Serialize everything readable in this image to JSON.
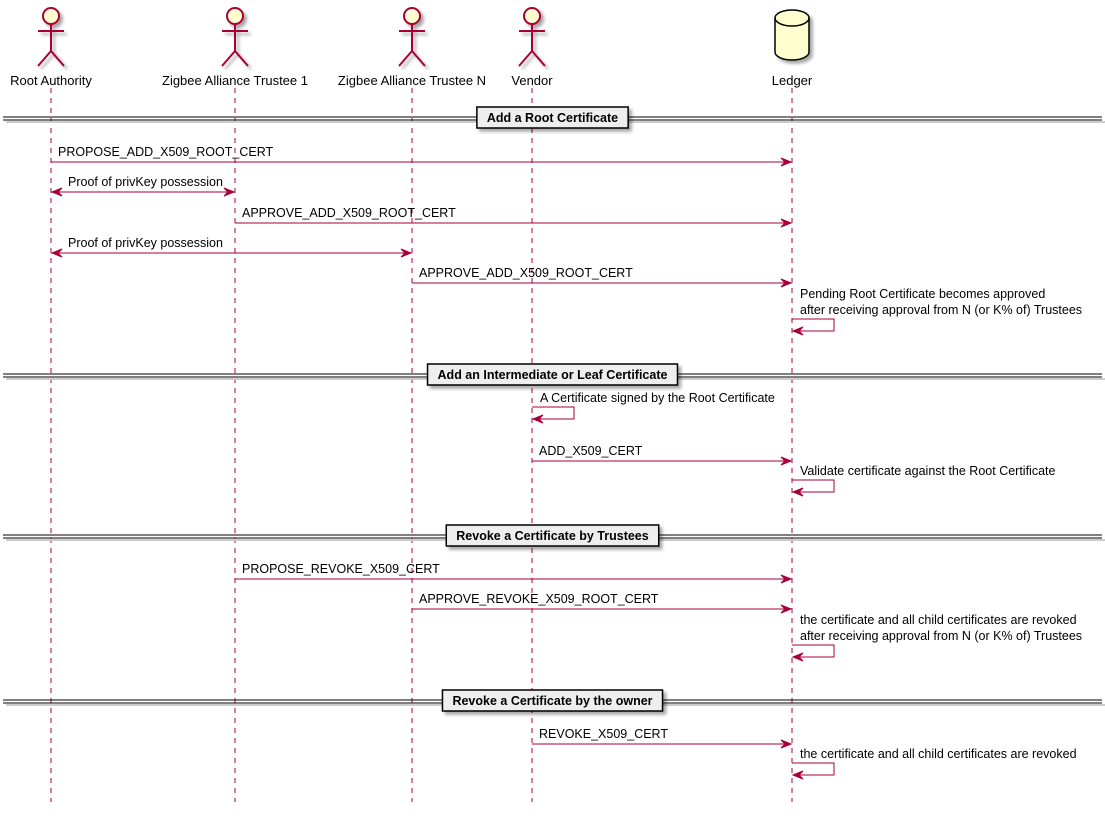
{
  "diagram": {
    "type": "sequence",
    "colors": {
      "line": "#A80036",
      "actor_fill": "#FEFECE",
      "divider_box_fill": "#EEEEEE",
      "text": "#000000"
    },
    "participants": [
      {
        "id": "root",
        "label": "Root Authority",
        "kind": "actor"
      },
      {
        "id": "t1",
        "label": "Zigbee Alliance Trustee 1",
        "kind": "actor"
      },
      {
        "id": "tn",
        "label": "Zigbee Alliance Trustee N",
        "kind": "actor"
      },
      {
        "id": "vendor",
        "label": "Vendor",
        "kind": "actor"
      },
      {
        "id": "ledger",
        "label": "Ledger",
        "kind": "database"
      }
    ],
    "sections": [
      {
        "title": "Add a Root Certificate",
        "messages": [
          {
            "from": "root",
            "to": "ledger",
            "type": "sync",
            "lines": [
              "PROPOSE_ADD_X509_ROOT_CERT"
            ]
          },
          {
            "from": "root",
            "to": "t1",
            "type": "bidirectional",
            "lines": [
              "Proof of privKey possession"
            ]
          },
          {
            "from": "t1",
            "to": "ledger",
            "type": "sync",
            "lines": [
              "APPROVE_ADD_X509_ROOT_CERT"
            ]
          },
          {
            "from": "root",
            "to": "tn",
            "type": "bidirectional",
            "lines": [
              "Proof of privKey possession"
            ]
          },
          {
            "from": "tn",
            "to": "ledger",
            "type": "sync",
            "lines": [
              "APPROVE_ADD_X509_ROOT_CERT"
            ]
          },
          {
            "from": "ledger",
            "to": "ledger",
            "type": "self",
            "lines": [
              "Pending Root Certificate becomes approved",
              "after receiving approval from N (or K% of) Trustees"
            ]
          }
        ]
      },
      {
        "title": "Add an Intermediate or Leaf Certificate",
        "messages": [
          {
            "from": "vendor",
            "to": "vendor",
            "type": "self",
            "lines": [
              "A Certificate signed by the Root Certificate"
            ]
          },
          {
            "from": "vendor",
            "to": "ledger",
            "type": "sync",
            "lines": [
              "ADD_X509_CERT"
            ]
          },
          {
            "from": "ledger",
            "to": "ledger",
            "type": "self",
            "lines": [
              "Validate certificate against the Root Certificate"
            ]
          }
        ]
      },
      {
        "title": "Revoke a Certificate by Trustees",
        "messages": [
          {
            "from": "t1",
            "to": "ledger",
            "type": "sync",
            "lines": [
              "PROPOSE_REVOKE_X509_CERT"
            ]
          },
          {
            "from": "tn",
            "to": "ledger",
            "type": "sync",
            "lines": [
              "APPROVE_REVOKE_X509_ROOT_CERT"
            ]
          },
          {
            "from": "ledger",
            "to": "ledger",
            "type": "self",
            "lines": [
              "the certificate and all child certificates are revoked",
              "after receiving approval from N (or K% of) Trustees"
            ]
          }
        ]
      },
      {
        "title": "Revoke a Certificate by the owner",
        "messages": [
          {
            "from": "vendor",
            "to": "ledger",
            "type": "sync",
            "lines": [
              "REVOKE_X509_CERT"
            ]
          },
          {
            "from": "ledger",
            "to": "ledger",
            "type": "self",
            "lines": [
              "the certificate and all child certificates are revoked"
            ]
          }
        ]
      }
    ]
  }
}
